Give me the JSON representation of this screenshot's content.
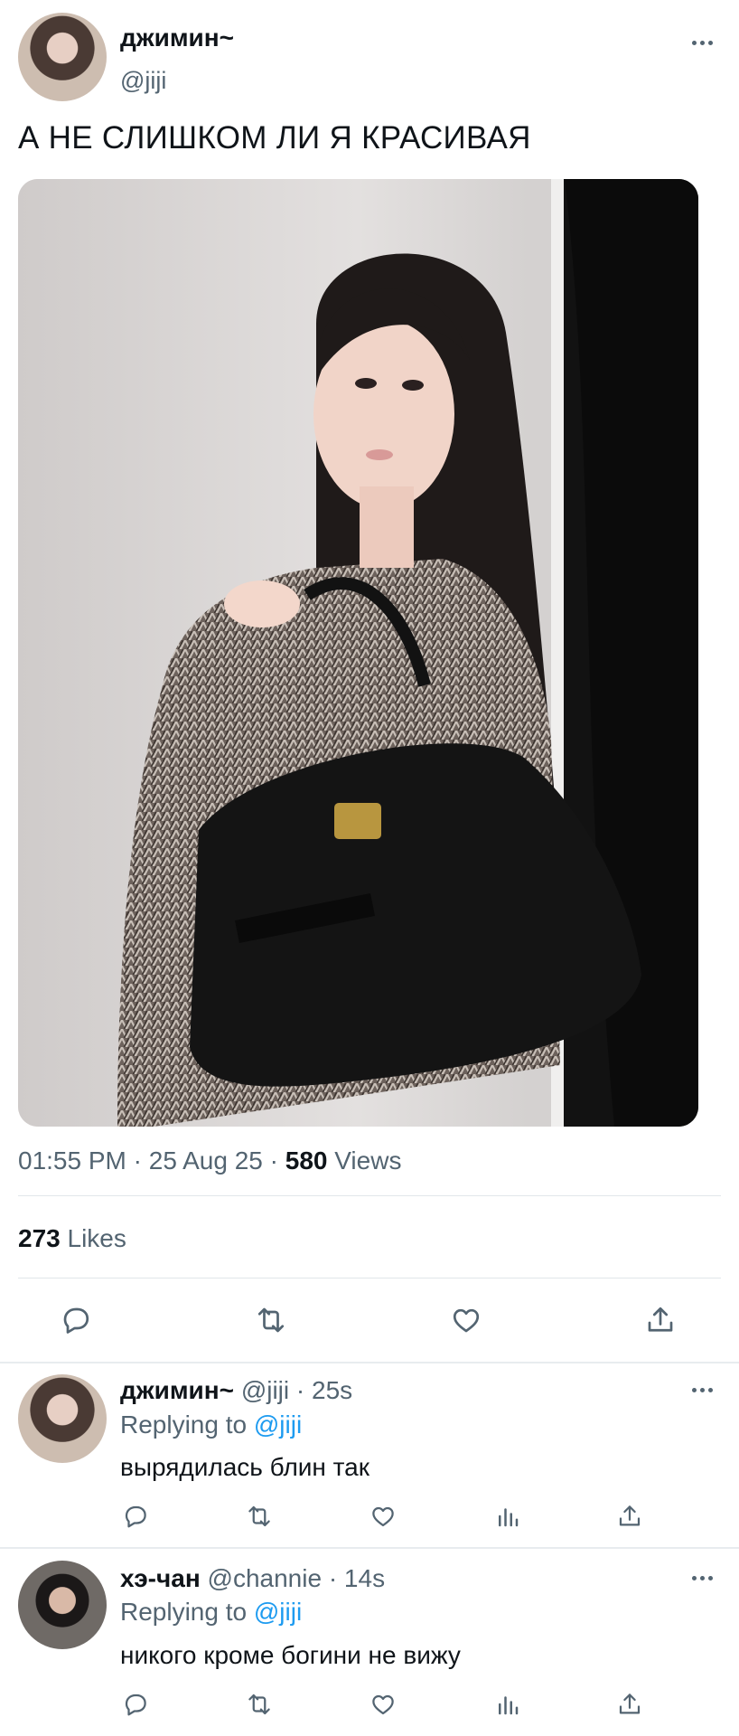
{
  "tweet": {
    "author_name": "джимин~",
    "author_handle": "@jiji",
    "text": "А НЕ СЛИШКОМ ЛИ Я КРАСИВАЯ",
    "time": "01:55 PM",
    "date": "25 Aug 25",
    "views_count": "580",
    "views_label": "Views",
    "likes_count": "273",
    "likes_label": "Likes",
    "separator": "·"
  },
  "actions": [
    "reply-icon",
    "retweet-icon",
    "like-icon",
    "share-icon"
  ],
  "replies": [
    {
      "name": "джимин~",
      "handle": "@jiji",
      "time": "25s",
      "replying_prefix": "Replying to",
      "replying_to": "@jiji",
      "text": "вырядилась блин так"
    },
    {
      "name": "хэ-чан",
      "handle": "@channie",
      "time": "14s",
      "replying_prefix": "Replying to",
      "replying_to": "@jiji",
      "text": "никого кроме богини не вижу"
    }
  ],
  "reply_actions": [
    "reply-icon",
    "retweet-icon",
    "like-icon",
    "stats-icon",
    "share-icon"
  ],
  "colors": {
    "text": "#0f1419",
    "muted": "#536471",
    "link": "#1d9bf0",
    "divider": "#e1e6ea"
  }
}
